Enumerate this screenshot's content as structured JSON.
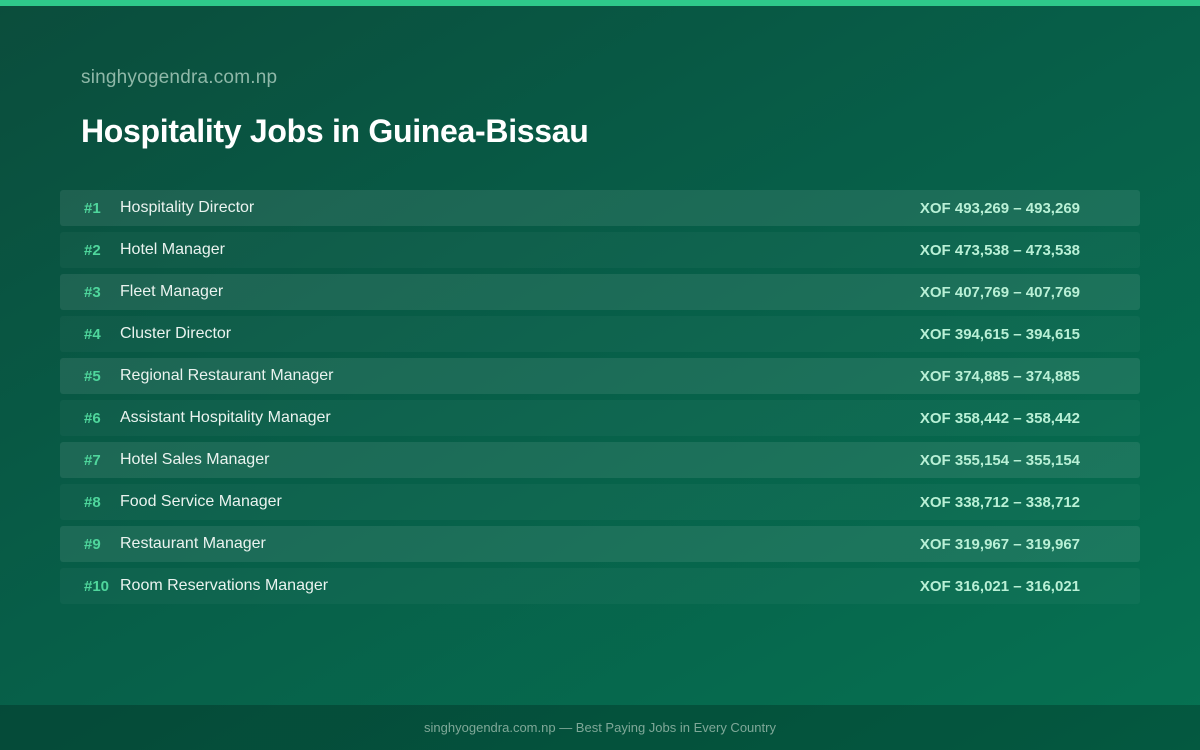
{
  "header": {
    "site_name": "singhyogendra.com.np",
    "title": "Hospitality Jobs in Guinea-Bissau"
  },
  "jobs": [
    {
      "rank": "#1",
      "title": "Hospitality Director",
      "salary": "XOF 493,269 – 493,269"
    },
    {
      "rank": "#2",
      "title": "Hotel Manager",
      "salary": "XOF 473,538 – 473,538"
    },
    {
      "rank": "#3",
      "title": "Fleet Manager",
      "salary": "XOF 407,769 – 407,769"
    },
    {
      "rank": "#4",
      "title": "Cluster Director",
      "salary": "XOF 394,615 – 394,615"
    },
    {
      "rank": "#5",
      "title": "Regional Restaurant Manager",
      "salary": "XOF 374,885 – 374,885"
    },
    {
      "rank": "#6",
      "title": "Assistant Hospitality Manager",
      "salary": "XOF 358,442 – 358,442"
    },
    {
      "rank": "#7",
      "title": "Hotel Sales Manager",
      "salary": "XOF 355,154 – 355,154"
    },
    {
      "rank": "#8",
      "title": "Food Service Manager",
      "salary": "XOF 338,712 – 338,712"
    },
    {
      "rank": "#9",
      "title": "Restaurant Manager",
      "salary": "XOF 319,967 – 319,967"
    },
    {
      "rank": "#10",
      "title": "Room Reservations Manager",
      "salary": "XOF 316,021 – 316,021"
    }
  ],
  "footer": {
    "text": "singhyogendra.com.np — Best Paying Jobs in Every Country"
  },
  "colors": {
    "accent": "#2ec98a",
    "rank": "#4fd69c",
    "salary": "#b9f0d6"
  }
}
